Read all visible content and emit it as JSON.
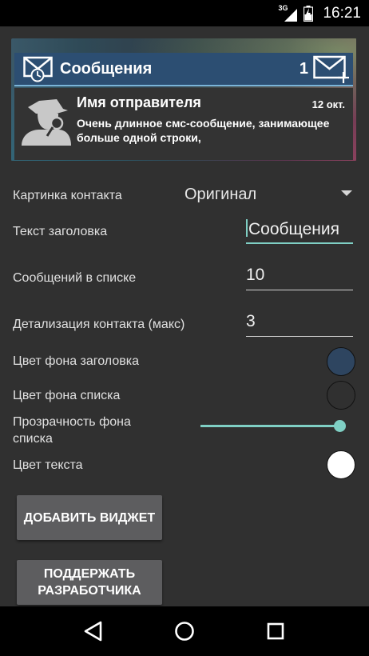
{
  "status_bar": {
    "network": "3G",
    "time": "16:21"
  },
  "preview": {
    "title": "Сообщения",
    "count": "1",
    "sender": "Имя отправителя",
    "date": "12 окт.",
    "message": "Очень длинное смс-сообщение, занимающее больше одной строки,"
  },
  "settings": {
    "contact_picture": {
      "label": "Картинка контакта",
      "value": "Оригинал"
    },
    "header_text": {
      "label": "Текст заголовка",
      "value": "Сообщения"
    },
    "messages_in_list": {
      "label": "Сообщений в списке",
      "value": "10"
    },
    "contact_detail": {
      "label": "Детализация контакта (макс)",
      "value": "3"
    },
    "header_bg_color": {
      "label": "Цвет фона заголовка",
      "color": "#2e4560"
    },
    "list_bg_color": {
      "label": "Цвет фона списка",
      "color": "#303030"
    },
    "list_bg_transparency": {
      "label": "Прозрачность фона списка",
      "level": 1.0
    },
    "text_color": {
      "label": "Цвет текста",
      "color": "#ffffff"
    }
  },
  "buttons": {
    "add_widget": "ДОБАВИТЬ ВИДЖЕТ",
    "support_developer": "ПОДДЕРЖАТЬ РАЗРАБОТЧИКА"
  },
  "nav": {
    "back": "back-icon",
    "home": "home-icon",
    "recents": "recents-icon"
  },
  "colors": {
    "accent": "#7fcfc4",
    "background": "#303030"
  }
}
